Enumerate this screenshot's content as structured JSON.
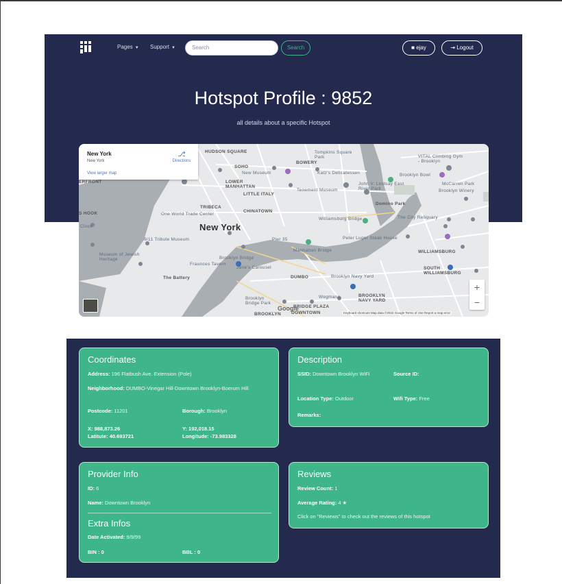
{
  "nav": {
    "pages_label": "Pages",
    "support_label": "Support",
    "search_placeholder": "Search",
    "search_button": "Search",
    "user_label": "ejay",
    "logout_label": "Logout"
  },
  "header": {
    "title": "Hotspot Profile : 9852",
    "subtitle": "all details about a specific Hotspot"
  },
  "map": {
    "place_title": "New York",
    "place_subtitle": "New York",
    "directions": "Directions",
    "view_larger": "View larger map",
    "zoom_in": "+",
    "zoom_out": "−",
    "google": "Google",
    "attribution": "Keyboard shortcuts   Map data ©2022 Google   Terms of Use   Report a map error",
    "labels": {
      "new_york": "New York",
      "hudson_square": "HUDSON SQUARE",
      "soho": "SOHO",
      "bowery": "BOWERY",
      "lower_manhattan": "LOWER MANHATTAN",
      "little_italy": "LITTLE ITALY",
      "tribeca": "TRIBECA",
      "chinatown": "CHINATOWN",
      "dumbo": "DUMBO",
      "williamsburg": "WILLIAMSBURG",
      "south_williamsburg": "SOUTH WILLIAMSBURG",
      "brooklyn_navy_yard": "BROOKLYN NAVY YARD",
      "bridge_plaza": "BRIDGE PLAZA",
      "downtown": "DOWNTOWN",
      "brooklyn": "BROOKLYN",
      "domino_park": "Domino Park",
      "brooklyn_bridge": "Brooklyn Bridge",
      "williamsburg_bridge": "Williamsburg Bridge",
      "manhattan_bridge": "Manhattan Bridge",
      "one_world": "One World Trade Center",
      "tribute": "9/11 Tribute Museum",
      "battery": "The Battery",
      "tompkins": "Tompkins Square Park",
      "new_museum": "New Museum",
      "katz": "Katz's Delicatessen",
      "tenement": "Tenement Museum",
      "brooklyn_bowl": "Brooklyn Bowl",
      "city_reliquary": "The City Reliquary",
      "peter_luger": "Peter Luger Steak House",
      "wegmans": "Wegmans",
      "brooklyn_navy_yard_poi": "Brooklyn Navy Yard",
      "brooklyn_bridge_park": "Brooklyn Bridge Park",
      "fraunces": "Fraunces Tavern",
      "jane": "Jane's Carousel",
      "vital": "VITAL Climbing Gym - Brooklyn",
      "mccarren": "McCarren Park",
      "brooklyn_winery": "Brooklyn Winery",
      "john_lindsay": "John V. Lindsay East River Park",
      "museum_jewish": "Museum of Jewish Heritage",
      "erfront": "ERFRONT",
      "hook": "S HOOK",
      "clock": "Clock",
      "pier": "Pier 35"
    }
  },
  "coordinates": {
    "title": "Coordinates",
    "address_label": "Address:",
    "address_value": "196 Flatbush Ave. Extension (Pole)",
    "neighborhood_label": "Neighborhood:",
    "neighborhood_value": "DUMBO-Vinegar Hill-Downtown Brooklyn-Boerum Hill",
    "postcode_label": "Postcode:",
    "postcode_value": "11201",
    "borough_label": "Borough:",
    "borough_value": "Brooklyn",
    "x_label": "X:",
    "x_value": "988,873.26",
    "y_label": "Y:",
    "y_value": "192,018.15",
    "latitude_label": "Latitute:",
    "latitude_value": "40.693721",
    "longitude_label": "Longitude:",
    "longitude_value": "-73.983328"
  },
  "description": {
    "title": "Description",
    "ssid_label": "SSID:",
    "ssid_value": "Downtown Brooklyn WiFi",
    "source_label": "Source ID:",
    "source_value": "",
    "location_label": "Location Type:",
    "location_value": "Outdoor",
    "wifi_label": "Wifi Type:",
    "wifi_value": "Free",
    "remarks_label": "Remarks:",
    "remarks_value": ""
  },
  "provider": {
    "title": "Provider Info",
    "id_label": "ID:",
    "id_value": "6",
    "name_label": "Name:",
    "name_value": "Downtown Brooklyn"
  },
  "extra": {
    "title": "Extra Infos",
    "date_label": "Date Activated:",
    "date_value": "9/9/99",
    "bin_label": "BIN :",
    "bin_value": "0",
    "bbl_label": "BBL :",
    "bbl_value": "0"
  },
  "reviews": {
    "title": "Reviews",
    "count_label": "Review Count:",
    "count_value": "1",
    "rating_label": "Average Rating:",
    "rating_value": "4",
    "hint": "Click on \"Reviews\" to check out the reviews of this hotspot"
  },
  "colors": {
    "navy": "#232a4d",
    "green": "#3fb58a"
  }
}
